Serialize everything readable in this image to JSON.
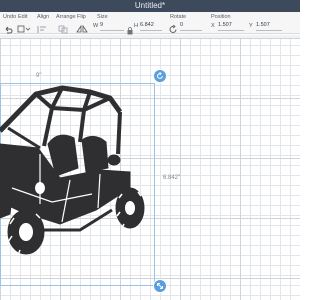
{
  "header": {
    "title": "Untitled*"
  },
  "toolbar": {
    "undo_label": "Undo",
    "edit_label": "Edit",
    "align_label": "Align",
    "arrange_label": "Arrange",
    "flip_label": "Flip",
    "size_label": "Size",
    "rotate_label": "Rotate",
    "position_label": "Position",
    "width_prefix": "W",
    "width_value": "9",
    "height_prefix": "H",
    "height_value": "6.842",
    "rotate_value": "0",
    "x_prefix": "X",
    "x_value": "1.507",
    "y_prefix": "Y",
    "y_value": "1.507"
  },
  "canvas": {
    "width_label": "9\"",
    "height_label": "6.842\""
  },
  "colors": {
    "accent": "#5a9ee0",
    "selection": "#9cc3e8",
    "topbar": "#3c4a5c",
    "artwork": "#2f2f31"
  },
  "icons": [
    "undo-icon",
    "edit-icon",
    "align-icon",
    "arrange-icon",
    "flip-icon",
    "lock-icon",
    "rotate-icon",
    "rotate-handle-icon",
    "scale-handle-icon"
  ]
}
